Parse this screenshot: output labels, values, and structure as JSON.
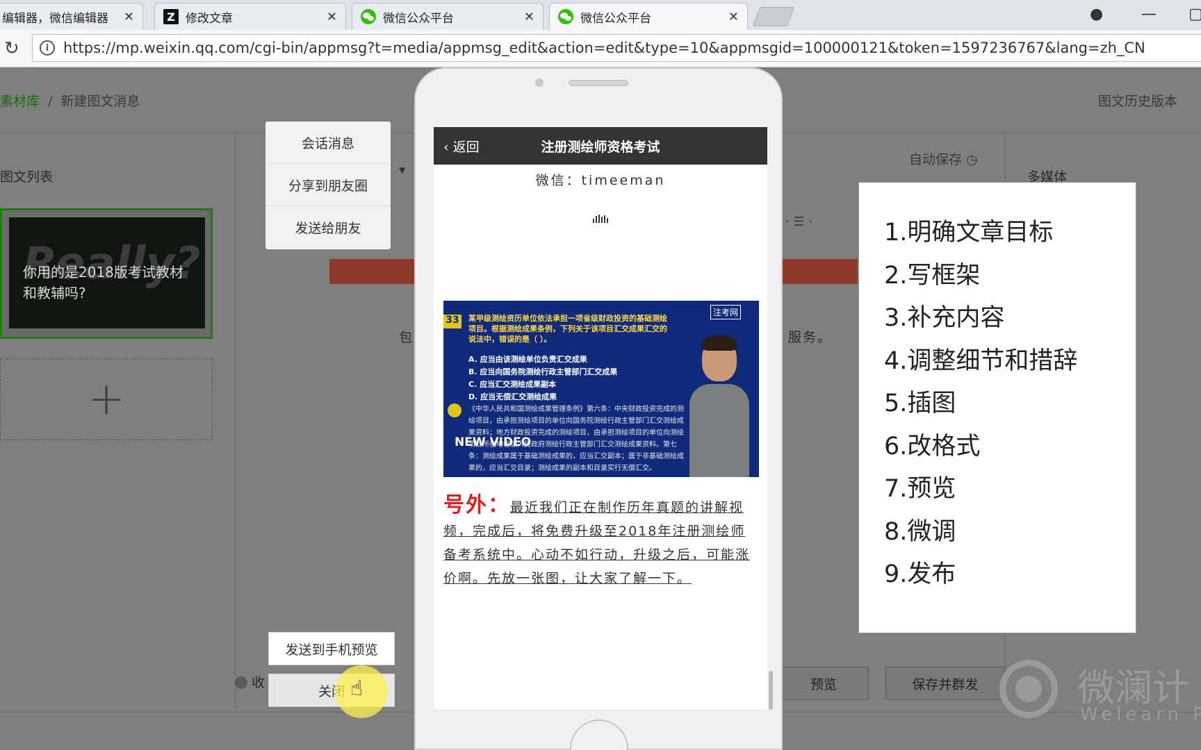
{
  "browser": {
    "tabs": [
      {
        "title": "编辑器，微信编辑器",
        "icon": "none"
      },
      {
        "title": "修改文章",
        "icon": "z-logo-icon"
      },
      {
        "title": "微信公众平台",
        "icon": "wechat-icon"
      },
      {
        "title": "微信公众平台",
        "icon": "wechat-icon"
      }
    ],
    "url": "https://mp.weixin.qq.com/cgi-bin/appmsg?t=media/appmsg_edit&action=edit&type=10&appmsgid=100000121&token=1597236767&lang=zh_CN"
  },
  "editor": {
    "breadcrumb_lib": "素材库",
    "breadcrumb_sep": "/",
    "breadcrumb_page": "新建图文消息",
    "history": "图文历史版本",
    "list_title": "图文列表",
    "article_bg_text": "Really?",
    "article_title": "你用的是2018版考试教材和教辅吗?",
    "add_label": "+",
    "autosave": "自动保存",
    "multimedia": "多媒体",
    "bg_bao": "包",
    "bg_service": "服务。",
    "collect": "收",
    "preview": "预览",
    "save_publish": "保存并群发"
  },
  "share_menu": [
    "会话消息",
    "分享到朋友圈",
    "发送给朋友"
  ],
  "actions": {
    "send_to_phone": "发送到手机预览",
    "close": "关闭"
  },
  "phone": {
    "back": "返回",
    "title": "注册测绘师资格考试",
    "wechat_id": "微信：timeeman",
    "video": {
      "number": "33",
      "logo": "注考网",
      "question": "某甲级测绘资历单位依法承担一项省级财政投资的基础测绘项目。根据测绘成果条例，下列关于该项目汇交成果汇交的说法中，错误的是（ ）。",
      "options": [
        "A. 应当由该测绘单位负责汇交成果",
        "B. 应当向国务院测绘行政主管部门汇交成果",
        "C. 应当汇交测绘成果副本",
        "D. 应当无偿汇交测绘成果"
      ],
      "law": "《中华人民共和国测绘成果管理条例》第六条：中央财政投资完成的测绘项目，由承担测绘项目的单位向国务院测绘行政主管部门汇交测绘成果资料；地方财政投资完成的测绘项目，由承担测绘项目的单位向测绘项目所在地省级人民政府测绘行政主管部门汇交测绘成果资料。第七条：测绘成果属于基础测绘成果的，应当汇交副本；属于非基础测绘成果的，应当汇交目录；测绘成果的副本和目录实行无偿汇交。",
      "badge": "NEW VIDEO"
    },
    "news_label": "号外：",
    "news_text": "最近我们正在制作历年真题的讲解视频，完成后，将免费升级至2018年注册测绘师备考系统中。心动不如行动，升级之后，可能涨价啊。先放一张图，让大家了解一下。"
  },
  "steps": [
    "1.明确文章目标",
    "2.写框架",
    "3.补充内容",
    "4.调整细节和措辞",
    "5.插图",
    "6.改格式",
    "7.预览",
    "8.微调",
    "9.发布"
  ],
  "watermark": {
    "cn": "微澜计",
    "en": "Welearn P"
  }
}
